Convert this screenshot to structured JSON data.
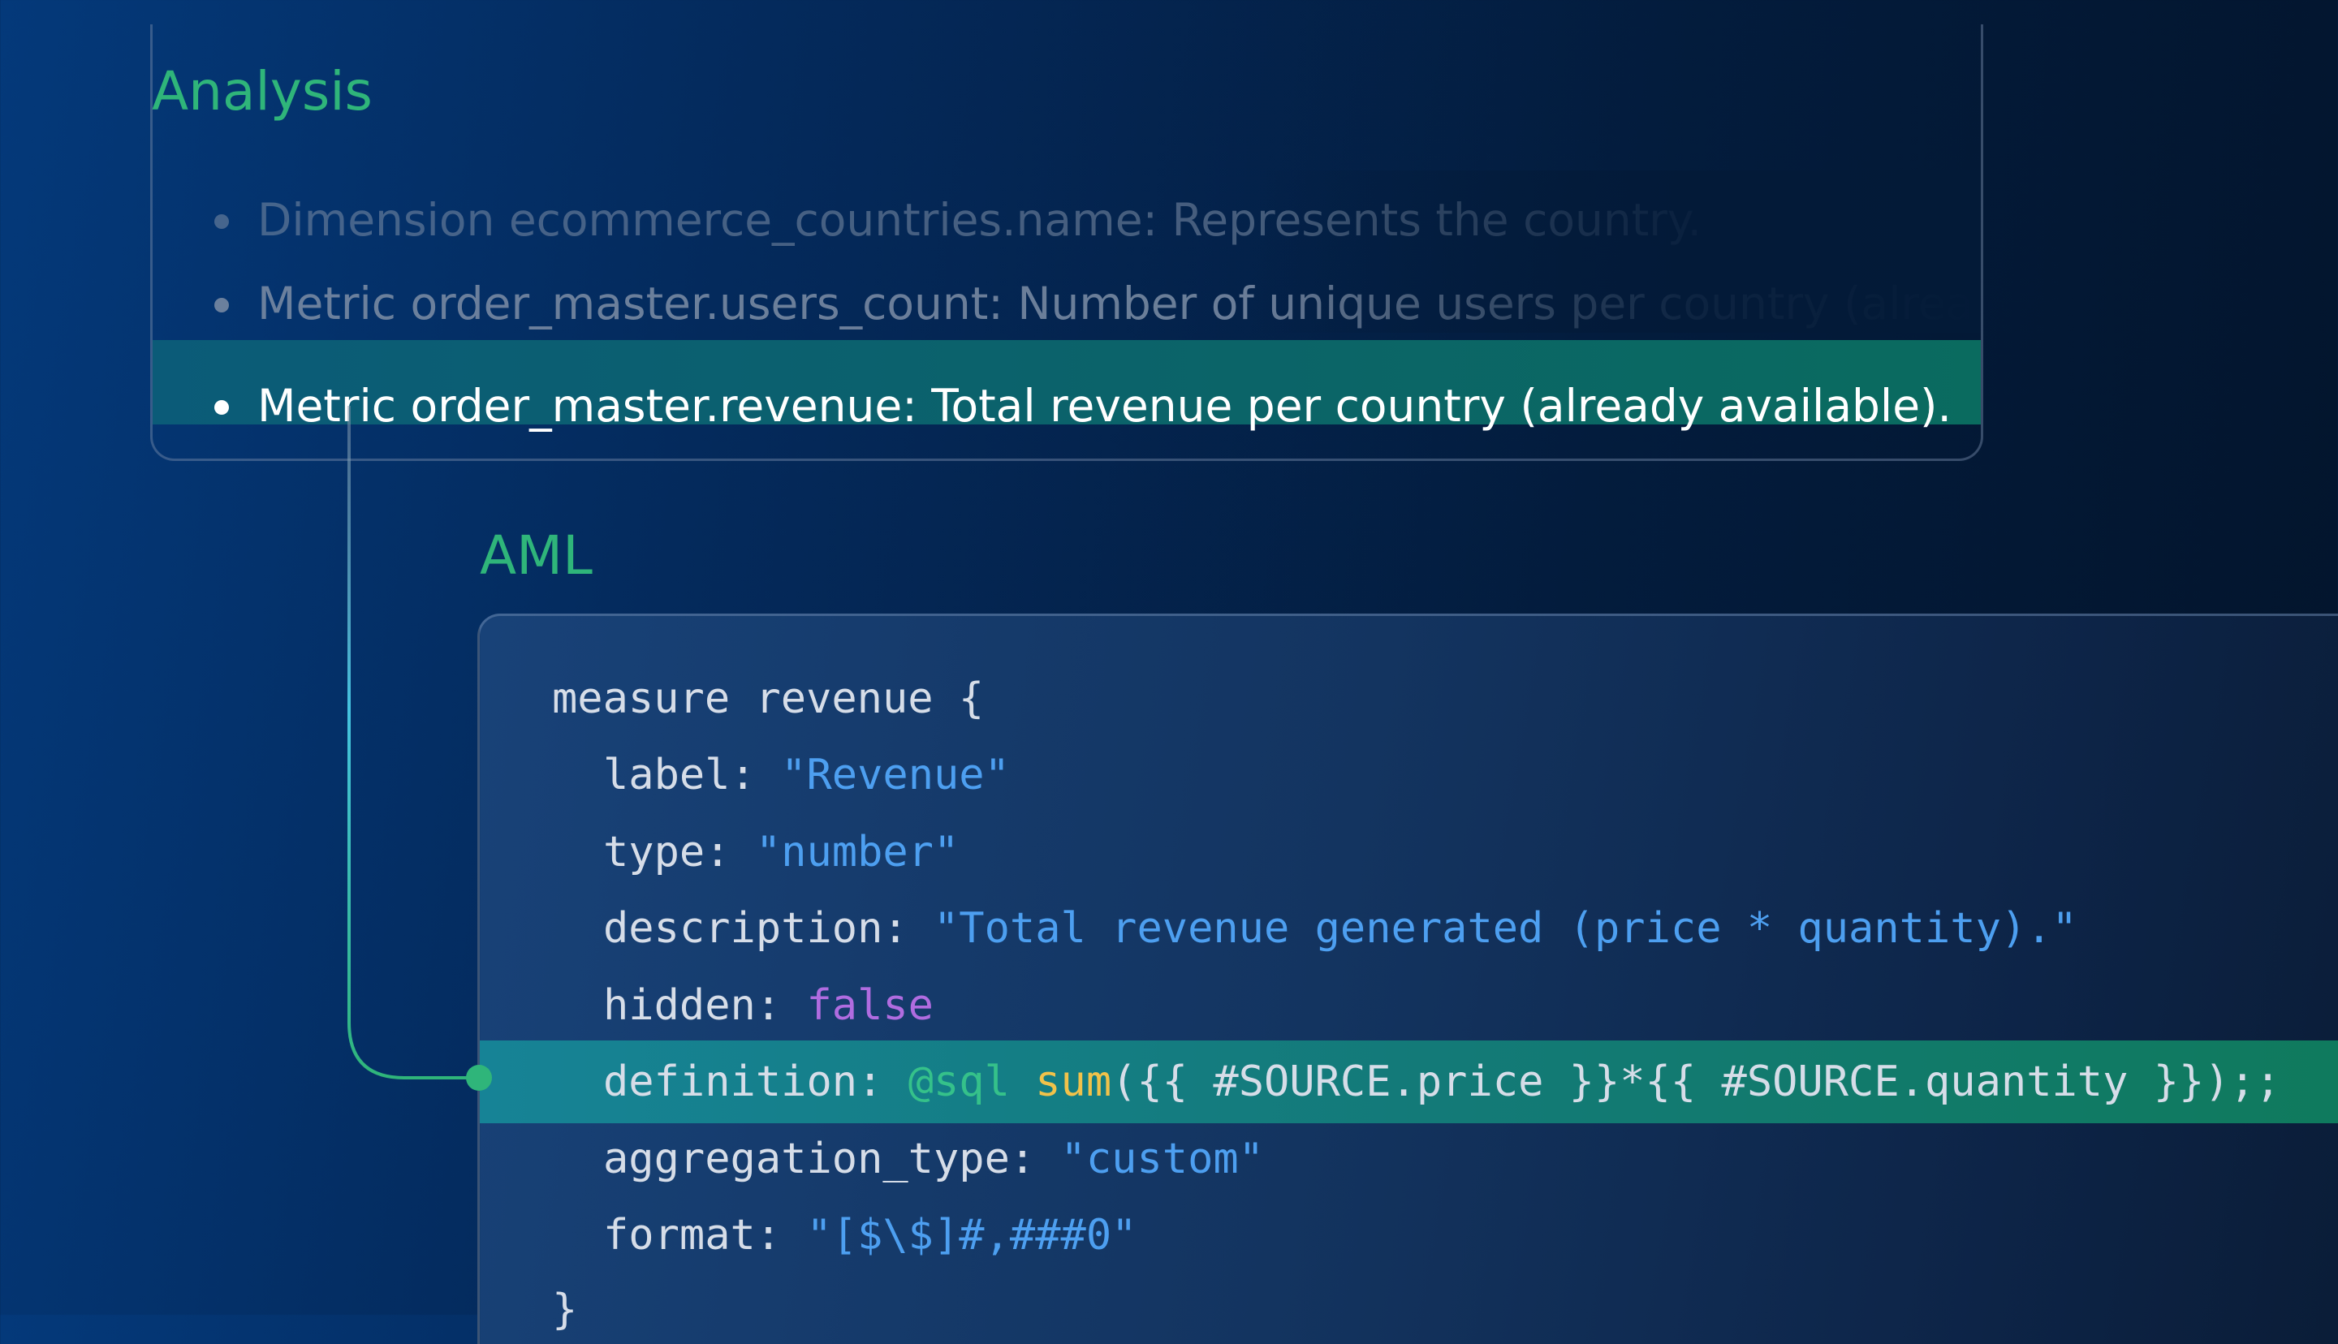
{
  "analysis": {
    "title": "Analysis",
    "items": [
      {
        "text": "Dimension ecommerce_countries.name: Represents the country."
      },
      {
        "text": "Metric order_master.users_count: Number of unique users per country (already available)."
      },
      {
        "text": "Metric order_master.revenue: Total revenue per country (already available)."
      }
    ]
  },
  "aml": {
    "title": "AML",
    "code": {
      "open": "measure revenue {",
      "label_key": "label: ",
      "label_val": "\"Revenue\"",
      "type_key": "type: ",
      "type_val": "\"number\"",
      "desc_key": "description: ",
      "desc_val": "\"Total revenue generated (price * quantity).\"",
      "hidden_key": "hidden: ",
      "hidden_val": "false",
      "def_key": "definition: ",
      "def_at": "@sql",
      "def_fn": "sum",
      "def_rest": "({{ #SOURCE.price }}*{{ #SOURCE.quantity }});;",
      "agg_key": "aggregation_type: ",
      "agg_val": "\"custom\"",
      "fmt_key": "format: ",
      "fmt_val": "\"[$\\$]#,###0\"",
      "close": "}"
    }
  },
  "colors": {
    "accent_green": "#2fb57a",
    "string_blue": "#4d9ff0",
    "boolean_purple": "#b06ce0",
    "function_yellow": "#f1c24a",
    "highlight_teal": "#0b6468"
  }
}
